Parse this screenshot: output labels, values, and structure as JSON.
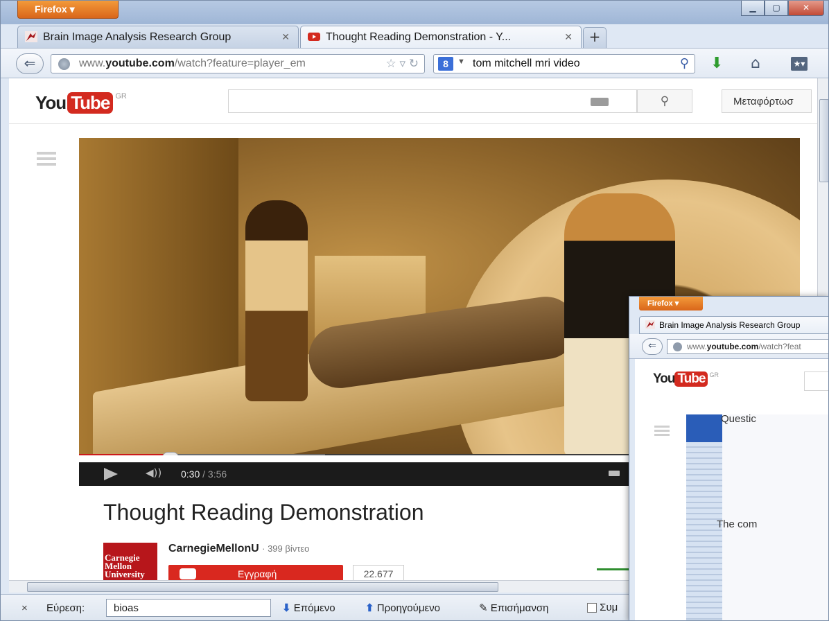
{
  "browser": {
    "menu_label": "Firefox ▾",
    "tabs": [
      {
        "title": "Brain Image Analysis Research Group"
      },
      {
        "title": "Thought Reading Demonstration - Y..."
      }
    ],
    "url_prefix": "www.",
    "url_domain": "youtube.com",
    "url_path": "/watch?feature=player_em",
    "search_query": "tom mitchell mri video"
  },
  "youtube": {
    "logo_you": "You",
    "logo_tube": "Tube",
    "region": "GR",
    "upload_label": "Μεταφόρτωσ",
    "video": {
      "current_time": "0:30",
      "duration": "/ 3:56",
      "progress_fraction": 0.1271,
      "title": "Thought Reading Demonstration"
    },
    "channel": {
      "logo_text": [
        "Carnegie",
        "Mellon",
        "University"
      ],
      "name": "CarnegieMellonU",
      "video_count": "· 399 βίντεο",
      "subscribe_label": "Εγγραφή",
      "subscriber_count": "22.677"
    }
  },
  "findbar": {
    "close": "×",
    "label": "Εύρεση:",
    "query": "bioas",
    "next": "Επόμενο",
    "previous": "Προηγούμενο",
    "highlight": "Επισήμανση",
    "match_case": "Συμ"
  },
  "second_window": {
    "menu_label": "Firefox ▾",
    "tab_title": "Brain Image Analysis Research Group",
    "url_prefix": "www.",
    "url_domain": "youtube.com",
    "url_path": "/watch?feat",
    "region": "GR",
    "text_question": "Questic",
    "text_the": "The com"
  },
  "colors": {
    "firefox_orange": "#e07a24",
    "youtube_red": "#d32a1f",
    "progress_red": "#cc1a1a"
  }
}
